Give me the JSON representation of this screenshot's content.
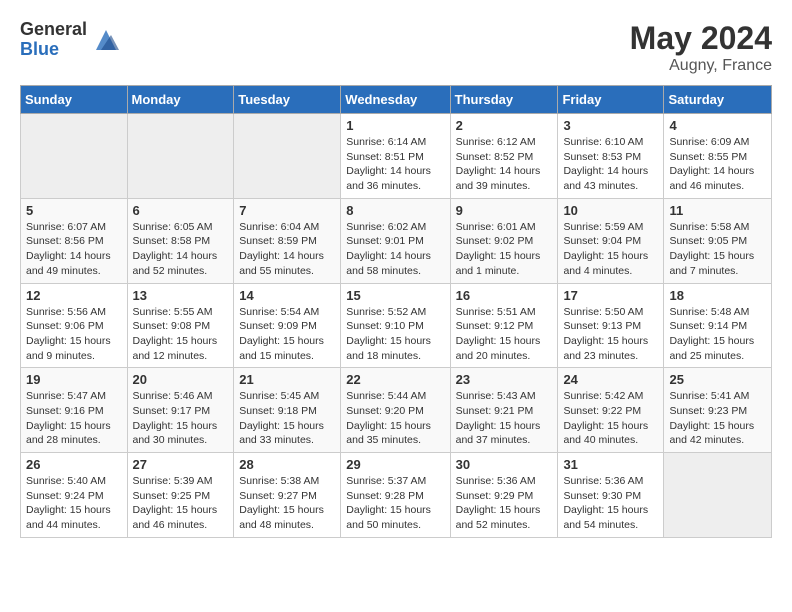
{
  "logo": {
    "general": "General",
    "blue": "Blue"
  },
  "title": {
    "month_year": "May 2024",
    "location": "Augny, France"
  },
  "days_of_week": [
    "Sunday",
    "Monday",
    "Tuesday",
    "Wednesday",
    "Thursday",
    "Friday",
    "Saturday"
  ],
  "weeks": [
    [
      {
        "day": "",
        "info": ""
      },
      {
        "day": "",
        "info": ""
      },
      {
        "day": "",
        "info": ""
      },
      {
        "day": "1",
        "info": "Sunrise: 6:14 AM\nSunset: 8:51 PM\nDaylight: 14 hours\nand 36 minutes."
      },
      {
        "day": "2",
        "info": "Sunrise: 6:12 AM\nSunset: 8:52 PM\nDaylight: 14 hours\nand 39 minutes."
      },
      {
        "day": "3",
        "info": "Sunrise: 6:10 AM\nSunset: 8:53 PM\nDaylight: 14 hours\nand 43 minutes."
      },
      {
        "day": "4",
        "info": "Sunrise: 6:09 AM\nSunset: 8:55 PM\nDaylight: 14 hours\nand 46 minutes."
      }
    ],
    [
      {
        "day": "5",
        "info": "Sunrise: 6:07 AM\nSunset: 8:56 PM\nDaylight: 14 hours\nand 49 minutes."
      },
      {
        "day": "6",
        "info": "Sunrise: 6:05 AM\nSunset: 8:58 PM\nDaylight: 14 hours\nand 52 minutes."
      },
      {
        "day": "7",
        "info": "Sunrise: 6:04 AM\nSunset: 8:59 PM\nDaylight: 14 hours\nand 55 minutes."
      },
      {
        "day": "8",
        "info": "Sunrise: 6:02 AM\nSunset: 9:01 PM\nDaylight: 14 hours\nand 58 minutes."
      },
      {
        "day": "9",
        "info": "Sunrise: 6:01 AM\nSunset: 9:02 PM\nDaylight: 15 hours\nand 1 minute."
      },
      {
        "day": "10",
        "info": "Sunrise: 5:59 AM\nSunset: 9:04 PM\nDaylight: 15 hours\nand 4 minutes."
      },
      {
        "day": "11",
        "info": "Sunrise: 5:58 AM\nSunset: 9:05 PM\nDaylight: 15 hours\nand 7 minutes."
      }
    ],
    [
      {
        "day": "12",
        "info": "Sunrise: 5:56 AM\nSunset: 9:06 PM\nDaylight: 15 hours\nand 9 minutes."
      },
      {
        "day": "13",
        "info": "Sunrise: 5:55 AM\nSunset: 9:08 PM\nDaylight: 15 hours\nand 12 minutes."
      },
      {
        "day": "14",
        "info": "Sunrise: 5:54 AM\nSunset: 9:09 PM\nDaylight: 15 hours\nand 15 minutes."
      },
      {
        "day": "15",
        "info": "Sunrise: 5:52 AM\nSunset: 9:10 PM\nDaylight: 15 hours\nand 18 minutes."
      },
      {
        "day": "16",
        "info": "Sunrise: 5:51 AM\nSunset: 9:12 PM\nDaylight: 15 hours\nand 20 minutes."
      },
      {
        "day": "17",
        "info": "Sunrise: 5:50 AM\nSunset: 9:13 PM\nDaylight: 15 hours\nand 23 minutes."
      },
      {
        "day": "18",
        "info": "Sunrise: 5:48 AM\nSunset: 9:14 PM\nDaylight: 15 hours\nand 25 minutes."
      }
    ],
    [
      {
        "day": "19",
        "info": "Sunrise: 5:47 AM\nSunset: 9:16 PM\nDaylight: 15 hours\nand 28 minutes."
      },
      {
        "day": "20",
        "info": "Sunrise: 5:46 AM\nSunset: 9:17 PM\nDaylight: 15 hours\nand 30 minutes."
      },
      {
        "day": "21",
        "info": "Sunrise: 5:45 AM\nSunset: 9:18 PM\nDaylight: 15 hours\nand 33 minutes."
      },
      {
        "day": "22",
        "info": "Sunrise: 5:44 AM\nSunset: 9:20 PM\nDaylight: 15 hours\nand 35 minutes."
      },
      {
        "day": "23",
        "info": "Sunrise: 5:43 AM\nSunset: 9:21 PM\nDaylight: 15 hours\nand 37 minutes."
      },
      {
        "day": "24",
        "info": "Sunrise: 5:42 AM\nSunset: 9:22 PM\nDaylight: 15 hours\nand 40 minutes."
      },
      {
        "day": "25",
        "info": "Sunrise: 5:41 AM\nSunset: 9:23 PM\nDaylight: 15 hours\nand 42 minutes."
      }
    ],
    [
      {
        "day": "26",
        "info": "Sunrise: 5:40 AM\nSunset: 9:24 PM\nDaylight: 15 hours\nand 44 minutes."
      },
      {
        "day": "27",
        "info": "Sunrise: 5:39 AM\nSunset: 9:25 PM\nDaylight: 15 hours\nand 46 minutes."
      },
      {
        "day": "28",
        "info": "Sunrise: 5:38 AM\nSunset: 9:27 PM\nDaylight: 15 hours\nand 48 minutes."
      },
      {
        "day": "29",
        "info": "Sunrise: 5:37 AM\nSunset: 9:28 PM\nDaylight: 15 hours\nand 50 minutes."
      },
      {
        "day": "30",
        "info": "Sunrise: 5:36 AM\nSunset: 9:29 PM\nDaylight: 15 hours\nand 52 minutes."
      },
      {
        "day": "31",
        "info": "Sunrise: 5:36 AM\nSunset: 9:30 PM\nDaylight: 15 hours\nand 54 minutes."
      },
      {
        "day": "",
        "info": ""
      }
    ]
  ]
}
